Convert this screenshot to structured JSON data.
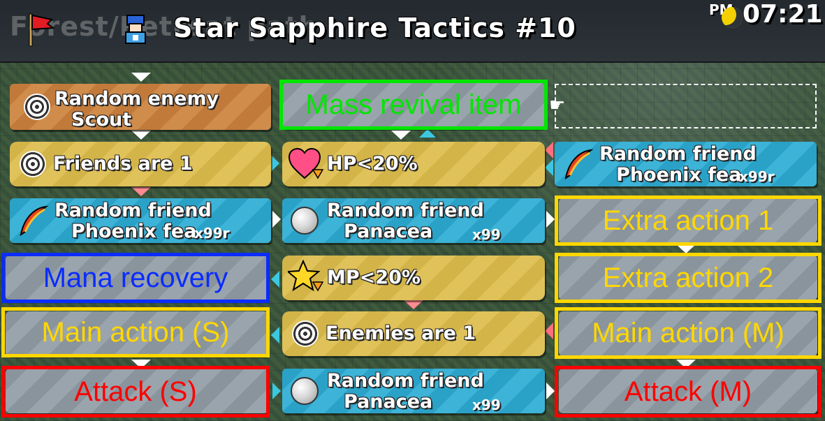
{
  "header": {
    "breadcrumb": "Forest/Retreat path",
    "title": "Star Sapphire Tactics #10",
    "clock_period": "PM",
    "clock_time": "07:21"
  },
  "cards": {
    "target_scout": {
      "line1": "Random enemy",
      "line2": "Scout"
    },
    "friends_are_1": {
      "line1": "Friends are 1"
    },
    "phoenix_left": {
      "line1": "Random friend",
      "line2": "Phoenix fea",
      "count": "x99r"
    },
    "hp_cond": {
      "line1": "HP<20%"
    },
    "panacea_mid": {
      "line1": "Random friend",
      "line2": "Panacea",
      "count": "x99"
    },
    "mp_cond": {
      "line1": "MP<20%"
    },
    "enemies_are_1": {
      "line1": "Enemies are 1"
    },
    "panacea_bottom": {
      "line1": "Random friend",
      "line2": "Panacea",
      "count": "x99"
    },
    "phoenix_right": {
      "line1": "Random friend",
      "line2": "Phoenix fea",
      "count": "x99r"
    }
  },
  "overlays": {
    "mass_revival": "Mass revival item",
    "extra_action_1": "Extra action 1",
    "extra_action_2": "Extra action 2",
    "mana_recovery": "Mana recovery",
    "main_action_s": "Main action (S)",
    "main_action_m": "Main action (M)",
    "attack_s": "Attack (S)",
    "attack_m": "Attack (M)"
  },
  "icons": {
    "target": "target-icon",
    "heart": "heart-icon",
    "star": "star-icon",
    "feather": "phoenix-feather-icon",
    "pearl": "panacea-icon",
    "flag": "flag-icon",
    "moon": "moon-icon",
    "pointer": "hand-pointer-icon"
  },
  "colors": {
    "overlay_yellow": "#ffd700",
    "overlay_red": "#ff0000",
    "overlay_blue": "#0a2cff",
    "overlay_green": "#00e600"
  }
}
